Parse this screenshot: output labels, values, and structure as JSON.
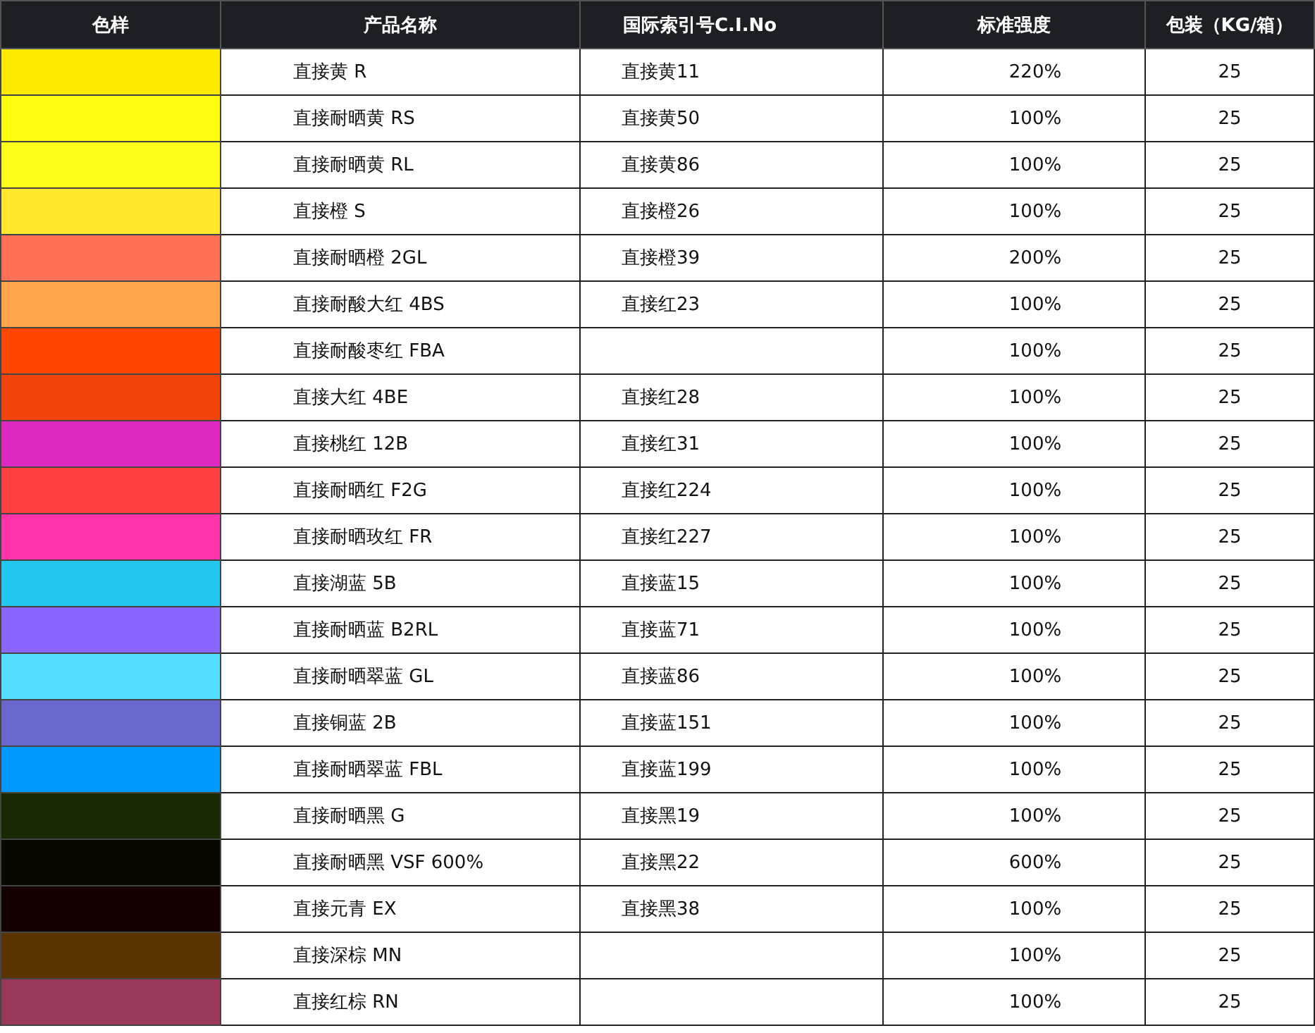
{
  "table": {
    "columns": [
      "色样",
      "产品名称",
      "国际索引号C.I.No",
      "标准强度",
      "包装（KG/箱）"
    ],
    "rows": [
      {
        "color": "#ffea00",
        "name": "直接黄 R",
        "ci": "直接黄11",
        "strength": "220%",
        "package": "25"
      },
      {
        "color": "#ffff14",
        "name": "直接耐晒黄 RS",
        "ci": "直接黄50",
        "strength": "100%",
        "package": "25"
      },
      {
        "color": "#ffff1c",
        "name": "直接耐晒黄 RL",
        "ci": "直接黄86",
        "strength": "100%",
        "package": "25"
      },
      {
        "color": "#ffe82e",
        "name": "直接橙 S",
        "ci": "直接橙26",
        "strength": "100%",
        "package": "25"
      },
      {
        "color": "#ff7256",
        "name": "直接耐晒橙 2GL",
        "ci": "直接橙39",
        "strength": "200%",
        "package": "25"
      },
      {
        "color": "#ffa64d",
        "name": "直接耐酸大红 4BS",
        "ci": "直接红23",
        "strength": "100%",
        "package": "25"
      },
      {
        "color": "#ff4500",
        "name": "直接耐酸枣红 FBA",
        "strength": "100%",
        "package": "25"
      },
      {
        "color": "#f0440a",
        "name": "直接大红 4BE",
        "ci": "直接红28",
        "strength": "100%",
        "package": "25"
      },
      {
        "color": "#dd29c0",
        "name": "直接桃红 12B",
        "ci": "直接红31",
        "strength": "100%",
        "package": "25"
      },
      {
        "color": "#ff4040",
        "name": "直接耐晒红 F2G",
        "ci": "直接红224",
        "strength": "100%",
        "package": "25"
      },
      {
        "color": "#ff33aa",
        "name": "直接耐晒玫红 FR",
        "ci": "直接红227",
        "strength": "100%",
        "package": "25"
      },
      {
        "color": "#22c8f0",
        "name": "直接湖蓝 5B",
        "ci": "直接蓝15",
        "strength": "100%",
        "package": "25"
      },
      {
        "color": "#8866ff",
        "name": "直接耐晒蓝 B2RL",
        "ci": "直接蓝71",
        "strength": "100%",
        "package": "25"
      },
      {
        "color": "#55ddff",
        "name": "直接耐晒翠蓝 GL",
        "ci": "直接蓝86",
        "strength": "100%",
        "package": "25"
      },
      {
        "color": "#6a68cc",
        "name": "直接铜蓝 2B",
        "ci": "直接蓝151",
        "strength": "100%",
        "package": "25"
      },
      {
        "color": "#0099ff",
        "name": "直接耐晒翠蓝 FBL",
        "ci": "直接蓝199",
        "strength": "100%",
        "package": "25"
      },
      {
        "color": "#182800",
        "name": "直接耐晒黑 G",
        "ci": "直接黑19",
        "strength": "100%",
        "package": "25"
      },
      {
        "color": "#080800",
        "name": "直接耐晒黑 VSF 600%",
        "ci": "直接黑22",
        "strength": "600%",
        "package": "25"
      },
      {
        "color": "#150000",
        "name": "直接元青 EX",
        "ci": "直接黑38",
        "strength": "100%",
        "package": "25"
      },
      {
        "color": "#5a3300",
        "name": "直接深棕 MN",
        "strength": "100%",
        "package": "25"
      },
      {
        "color": "#99375a",
        "name": "直接红棕 RN",
        "strength": "100%",
        "package": "25"
      }
    ]
  }
}
